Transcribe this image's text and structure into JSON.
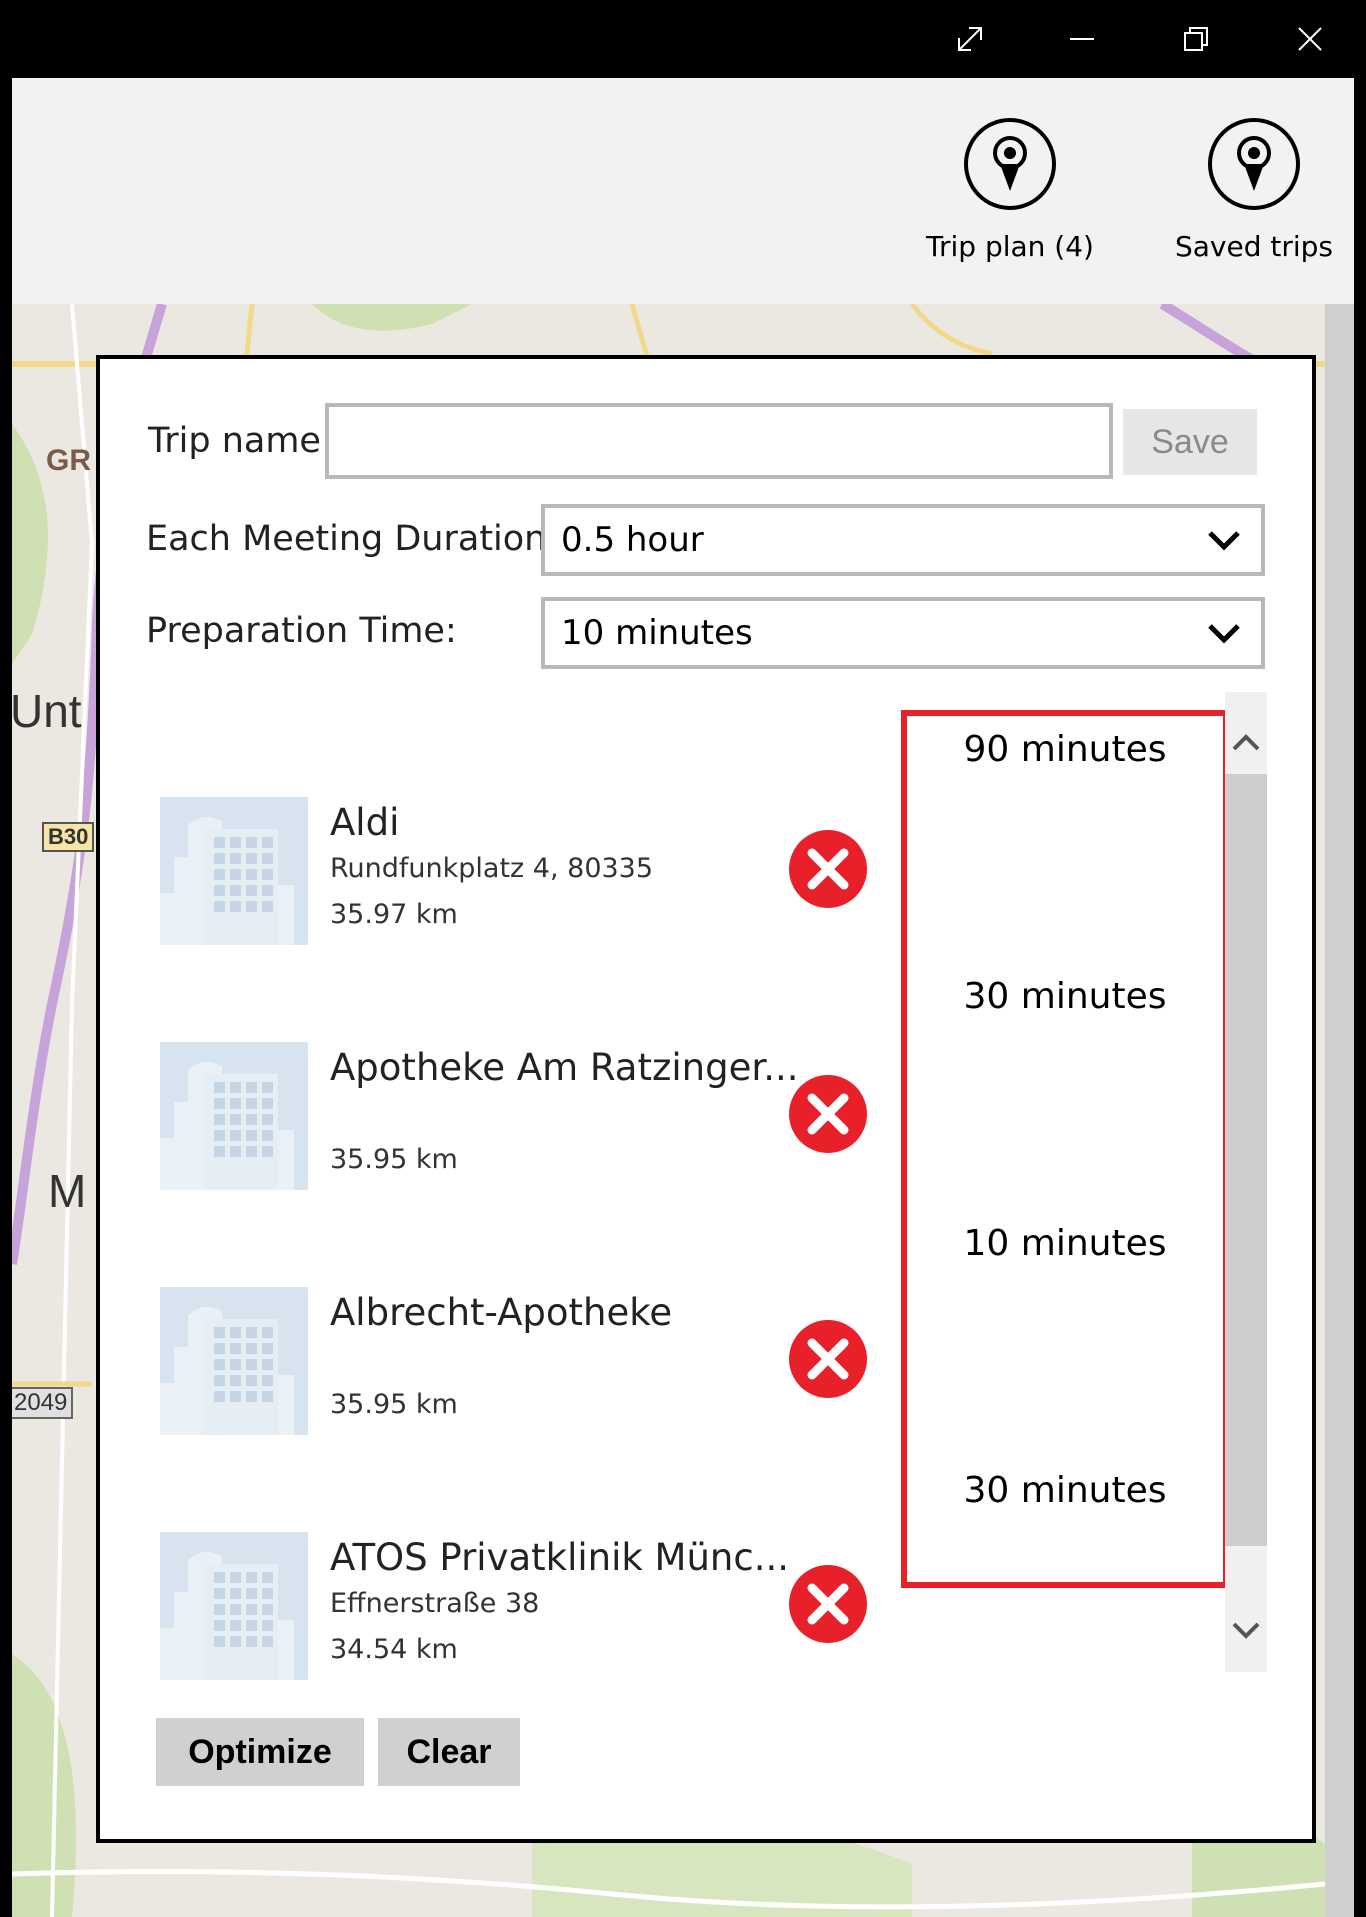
{
  "window": {
    "controls": [
      "expand-icon",
      "minimize-icon",
      "restore-icon",
      "close-icon"
    ]
  },
  "command_bar": {
    "trip_plan_label": "Trip plan (4)",
    "saved_trips_label": "Saved trips",
    "icon": "map-pin-icon"
  },
  "map": {
    "labels": [
      "GR",
      "Unt",
      "B30",
      "M",
      "2049"
    ]
  },
  "dialog": {
    "trip_name_label": "Trip name:",
    "trip_name_value": "",
    "save_label": "Save",
    "meeting_duration_label": "Each Meeting Duration:",
    "meeting_duration_value": "0.5 hour",
    "prep_time_label": "Preparation Time:",
    "prep_time_value": "10 minutes",
    "optimize_label": "Optimize",
    "clear_label": "Clear"
  },
  "stops": [
    {
      "name": "Aldi",
      "address": "Rundfunkplatz 4, 80335",
      "distance": "35.97 km"
    },
    {
      "name": "Apotheke Am Ratzinger...",
      "address": "",
      "distance": "35.95 km"
    },
    {
      "name": "Albrecht-Apotheke",
      "address": "",
      "distance": "35.95 km"
    },
    {
      "name": "ATOS Privatklinik Münc...",
      "address": "Effnerstraße 38",
      "distance": "34.54 km"
    }
  ],
  "durations": [
    "90 minutes",
    "30 minutes",
    "10 minutes",
    "30 minutes"
  ],
  "colors": {
    "highlight": "#e8202a",
    "remove": "#e8202a",
    "thumb": "#d7e3ee"
  }
}
